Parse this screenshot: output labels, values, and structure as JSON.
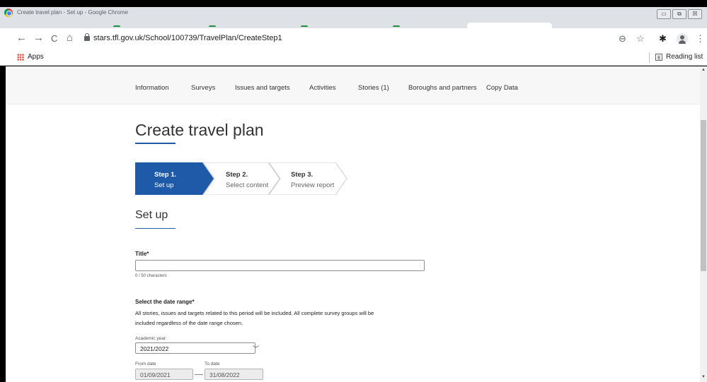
{
  "window": {
    "title": "Create travel plan - Set up - Google Chrome",
    "min": "▭",
    "restore": "⧉",
    "close": "☒"
  },
  "toolbar": {
    "back": "←",
    "forward": "→",
    "reload": "C",
    "home": "⌂",
    "url": "stars.tfl.gov.uk/School/100739/TravelPlan/CreateStep1",
    "zoom": "⊖",
    "star": "☆",
    "extensions": "✱",
    "menu": "⋮"
  },
  "bookmarks": {
    "apps": "Apps",
    "reading_list": "Reading list"
  },
  "subnav": [
    "Information",
    "Surveys",
    "Issues and targets",
    "Activities",
    "Stories (1)",
    "Boroughs and partners",
    "Copy Data"
  ],
  "page": {
    "title": "Create travel plan",
    "steps": [
      {
        "num": "Step 1.",
        "label": "Set up",
        "active": true
      },
      {
        "num": "Step 2.",
        "label": "Select content",
        "active": false
      },
      {
        "num": "Step 3.",
        "label": "Preview report",
        "active": false
      }
    ],
    "section_title": "Set up",
    "title_field": {
      "label": "Title*",
      "value": "",
      "placeholder": "",
      "count": "0 / 50 characters"
    },
    "date_range": {
      "label": "Select the date range*",
      "help1": "All stories, issues and targets related to this period will be included. All complete survey groups will be",
      "help2": "included regardless of the date range chosen.",
      "year_label": "Academic year:",
      "year_value": "2021/2022",
      "from_label": "From date",
      "from_value": "01/09/2021",
      "to_label": "To date",
      "to_value": "31/08/2022"
    }
  },
  "colors": {
    "accent": "#1e5aa8",
    "step_active": "#1e5aa8",
    "chevron": "#6b2c91"
  }
}
